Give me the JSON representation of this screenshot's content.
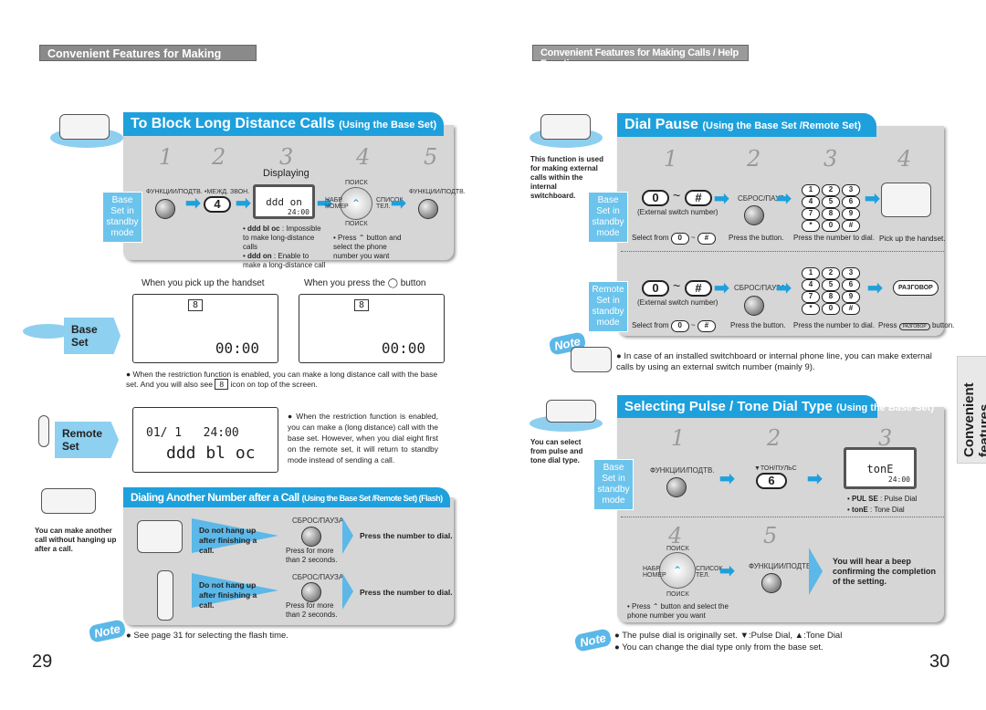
{
  "left": {
    "header": "Convenient Features for Making Calls",
    "block": {
      "title": "To Block Long Distance Calls",
      "subtitle": "(Using the Base Set)",
      "steps": [
        "1",
        "2",
        "3",
        "4",
        "5"
      ],
      "mode": "Base Set in standby mode",
      "func_btn": "ФУНКЦИИ/ПОДТВ.",
      "key_label": "•МЕЖД. ЗВОН.",
      "key": "4",
      "displaying": "Displaying",
      "lcd_text": "ddd on",
      "lcd_time": "24:00",
      "nav_top": "ПОИСК",
      "nav_bottom": "ПОИСК",
      "nav_left": "НАБР. НОМЕР",
      "nav_right": "СПИСОК ТЕЛ.",
      "bullet1_code": "ddd bl oc",
      "bullet1": ": Impossible to make long-distance calls",
      "bullet2_code": "ddd on",
      "bullet2": ": Enable to make a long-distance call",
      "press": "• Press",
      "press_btn": "button",
      "press_rest": "and select the phone number you want"
    },
    "base_set_label": "Base Set",
    "remote_set_label": "Remote Set",
    "handset_caption": "When you pick up the handset",
    "press_caption_a": "When you press the",
    "press_caption_b": "button",
    "lcd_num": "8",
    "lcd_time": "00:00",
    "restriction_note_a": "When the restriction function is enabled, you can make a long distance call with the base set. And you will also see",
    "restriction_note_b": "icon on top of the screen.",
    "remote_lcd_line1": "01/ 1   24:00",
    "remote_lcd_line2": "ddd bl oc",
    "remote_note": "When the restriction function is enabled, you can make a (long distance) call with the base set. However, when you dial eight first on the remote set, it will return to standby mode instead of sending a call.",
    "flash": {
      "title": "Dialing Another Number after a Call",
      "subtitle": "(Using the Base Set /Remote Set) (Flash)",
      "side_note": "You can make another call without hanging up after a call.",
      "rows": [
        {
          "btn": "СБРОС/ПАУЗА",
          "hang": "Do not hang up after finishing a call.",
          "hold": "Press for more than 2 seconds.",
          "result": "Press the number to dial."
        },
        {
          "btn": "СБРОС/ПАУЗА",
          "hang": "Do not hang up after finishing a call.",
          "hold": "Press for more than 2 seconds.",
          "result": "Press the number to dial."
        }
      ]
    },
    "note_label": "Note",
    "note": "See page 31 for selecting the flash time.",
    "page": "29"
  },
  "right": {
    "header": "Convenient Features for Making Calls / Help Functions",
    "pause": {
      "title": "Dial Pause",
      "subtitle": "(Using the Base Set /Remote Set)",
      "side_note": "This function is used for making external calls within the internal switchboard.",
      "steps": [
        "1",
        "2",
        "3",
        "4"
      ],
      "base_mode": "Base Set in standby mode",
      "remote_mode": "Remote Set in standby mode",
      "key0": "0",
      "tilde": "~",
      "keyhash": "#",
      "ext": "(External switch number)",
      "btn": "СБРОС/ПАУЗА",
      "keypad": [
        "1",
        "2",
        "3",
        "4",
        "5",
        "6",
        "7",
        "8",
        "9",
        "*",
        "0",
        "#"
      ],
      "base_caps": [
        "Select from",
        "Press the button.",
        "Press the number to dial.",
        "Pick up the handset."
      ],
      "remote_caps": [
        "Select from",
        "Press the button.",
        "Press the number to dial.",
        "Press",
        "button."
      ],
      "talk": "РАЗГОВОР"
    },
    "note_label": "Note",
    "note1": "In case of an installed switchboard or internal phone line, you can make external calls by using an external switch number (mainly 9).",
    "side_tab": "Convenient features",
    "pulse": {
      "title": "Selecting Pulse / Tone Dial Type",
      "subtitle": "(Using the Base Set)",
      "side_note": "You can select from pulse and tone dial type.",
      "steps": [
        "1",
        "2",
        "3",
        "4",
        "5"
      ],
      "mode": "Base Set in standby mode",
      "func_btn": "ФУНКЦИИ/ПОДТВ.",
      "key_label": "▼ТОН/ПУЛЬС",
      "key": "6",
      "lcd_text": "tonE",
      "lcd_time": "24:00",
      "pulse_code": "PUL SE",
      "pulse_desc": ": Pulse Dial",
      "tone_code": "tonE",
      "tone_desc": ": Tone Dial",
      "press": "• Press",
      "press_rest": "button and select the phone number you want",
      "nav_top": "ПОИСК",
      "nav_bottom": "ПОИСК",
      "nav_left": "НАБР. НОМЕР",
      "nav_right": "СПИСОК ТЕЛ.",
      "result": "You will hear a beep confirming the completion of the setting."
    },
    "notes2": [
      "The pulse dial is originally set. ▼:Pulse Dial, ▲:Tone Dial",
      "You can change the dial type only from the base set."
    ],
    "page": "30"
  },
  "colors": {
    "accent": "#1ea0dc",
    "panel": "#d6d6d6",
    "header": "#8a8a8a"
  }
}
